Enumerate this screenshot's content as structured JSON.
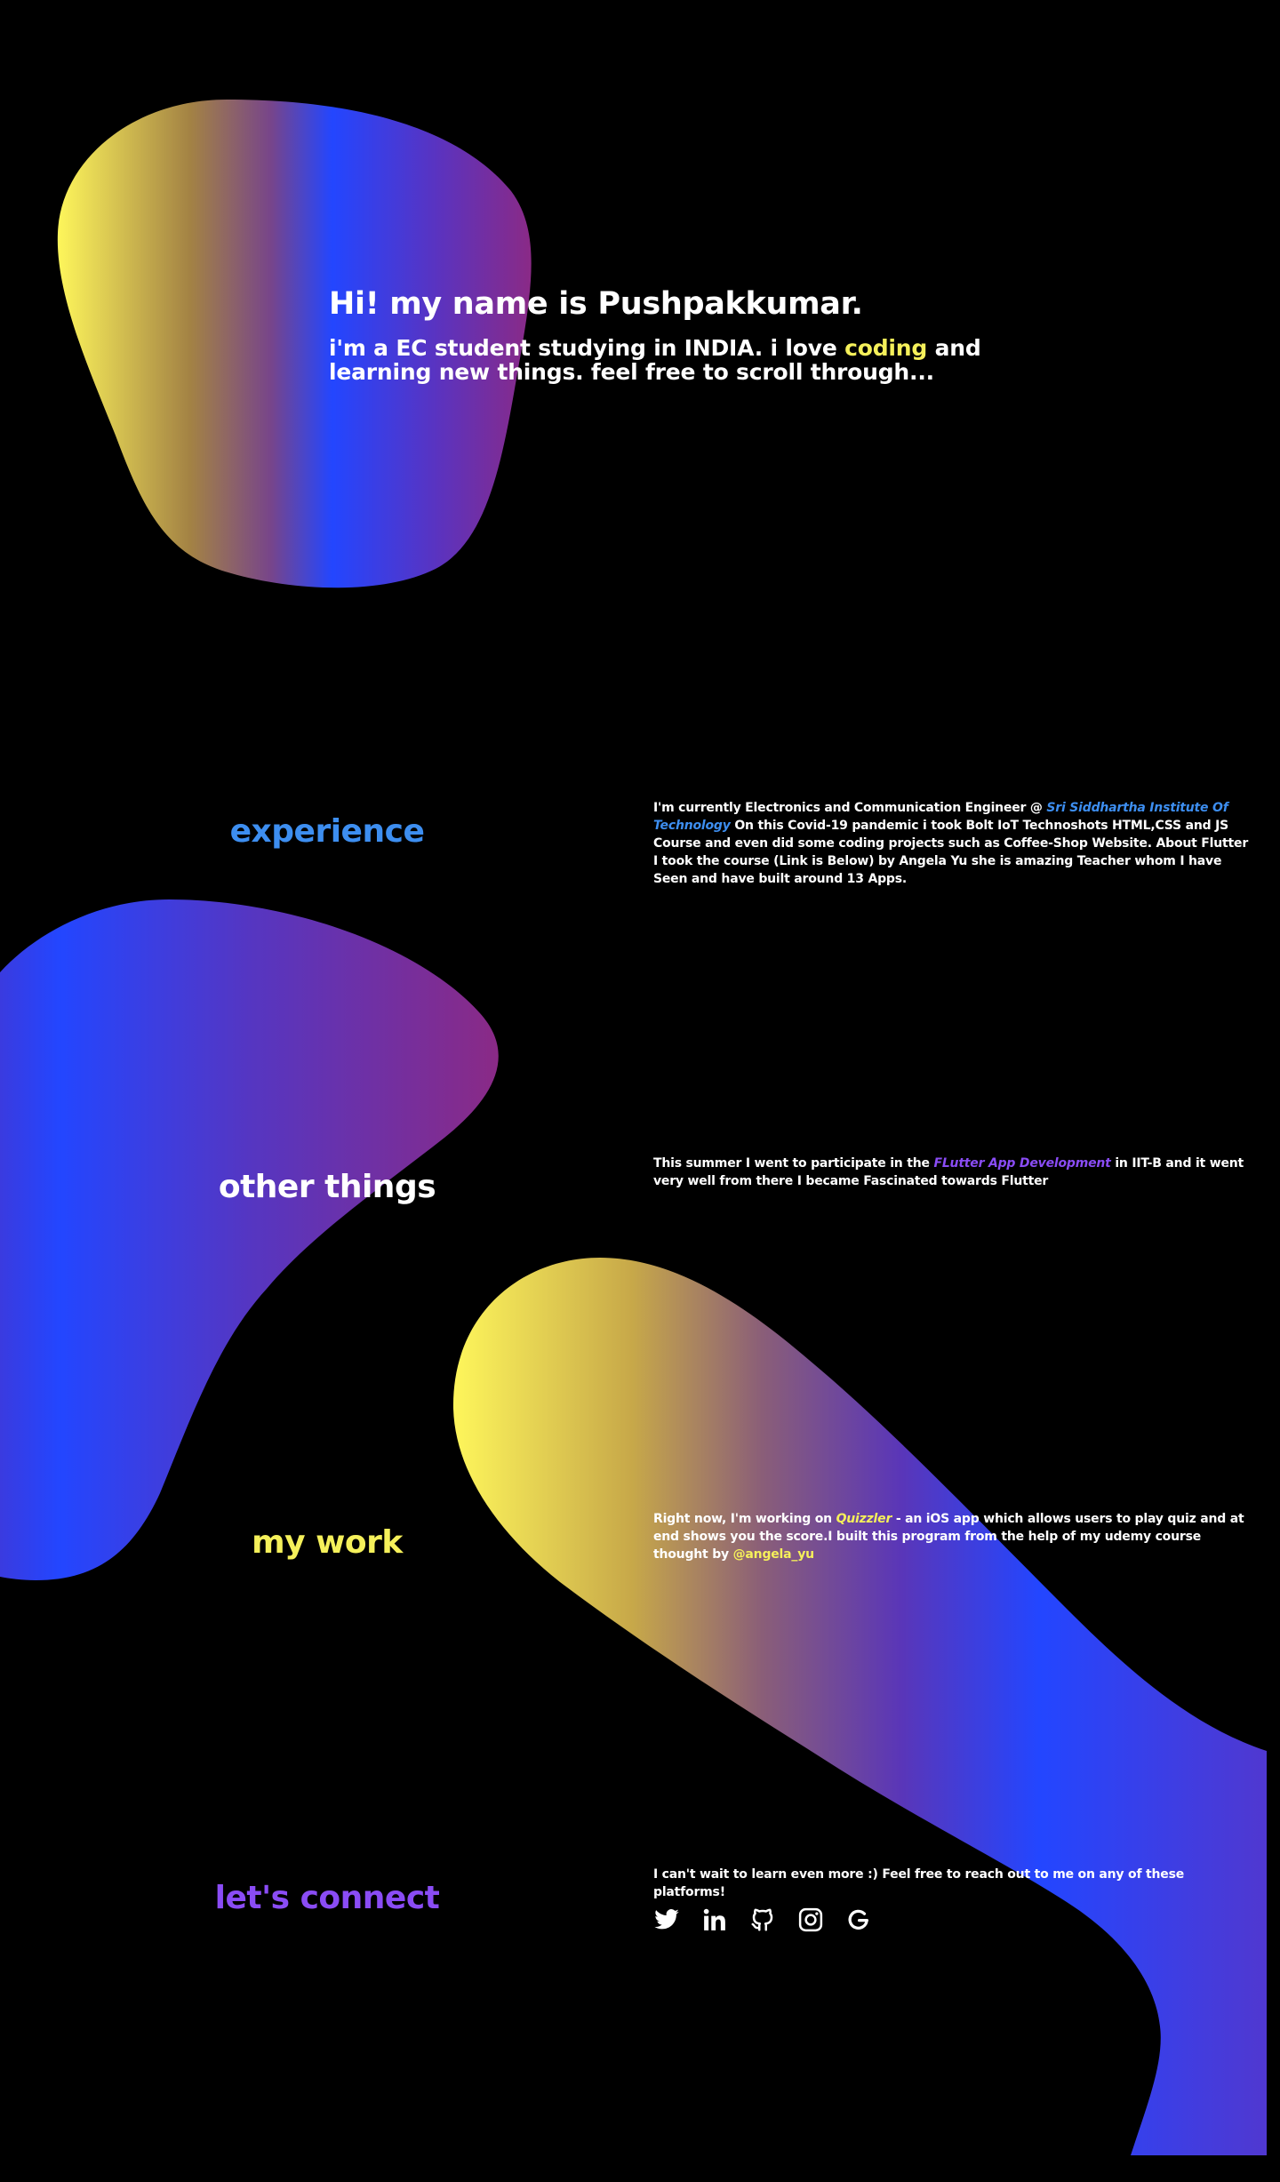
{
  "colors": {
    "background": "#000000",
    "yellow": "#f5f05a",
    "blue": "#3d8ef0",
    "purple": "#8a4cf5",
    "gradient_stops": [
      "#fef65b",
      "#7b2f8e",
      "#2346ff",
      "#6a32b0"
    ]
  },
  "hero": {
    "title": "Hi! my name is Pushpakkumar.",
    "subtitle_pre": "i'm a EC student studying in INDIA. i love ",
    "subtitle_highlight": "coding",
    "subtitle_post": " and learning new things. feel free to scroll through..."
  },
  "experience": {
    "title": "experience",
    "title_color": "#3d8ef0",
    "text_pre": "I'm currently Electronics and Communication Engineer @ ",
    "text_link": "Sri Siddhartha Institute Of Technology",
    "text_post": " On this Covid-19 pandemic i took Bolt IoT Technoshots HTML,CSS and JS Course and even did some coding projects such as Coffee-Shop Website. About Flutter I took the course (Link is Below) by Angela Yu she is amazing Teacher whom I have Seen and have built around 13 Apps."
  },
  "other_things": {
    "title": "other things",
    "title_color": "#ffffff",
    "text_pre": "This summer I went to participate in the ",
    "text_link": "FLutter App Development",
    "text_post": " in IIT-B and it went very well from there I became Fascinated towards Flutter"
  },
  "my_work": {
    "title": "my work",
    "title_color": "#f5f05a",
    "text_pre": "Right now, I'm working on ",
    "text_link": "Quizzler",
    "text_mid": " - an iOS app which allows users to play quiz and at end shows you the score.I built this program from the help of my udemy course thought by ",
    "text_handle": "@angela_yu"
  },
  "connect": {
    "title": "let's connect",
    "title_color": "#8a4cf5",
    "text": "I can't wait to learn even more :) Feel free to reach out to me on any of these platforms!",
    "icons": [
      "twitter-icon",
      "linkedin-icon",
      "github-icon",
      "instagram-icon",
      "google-icon"
    ]
  }
}
